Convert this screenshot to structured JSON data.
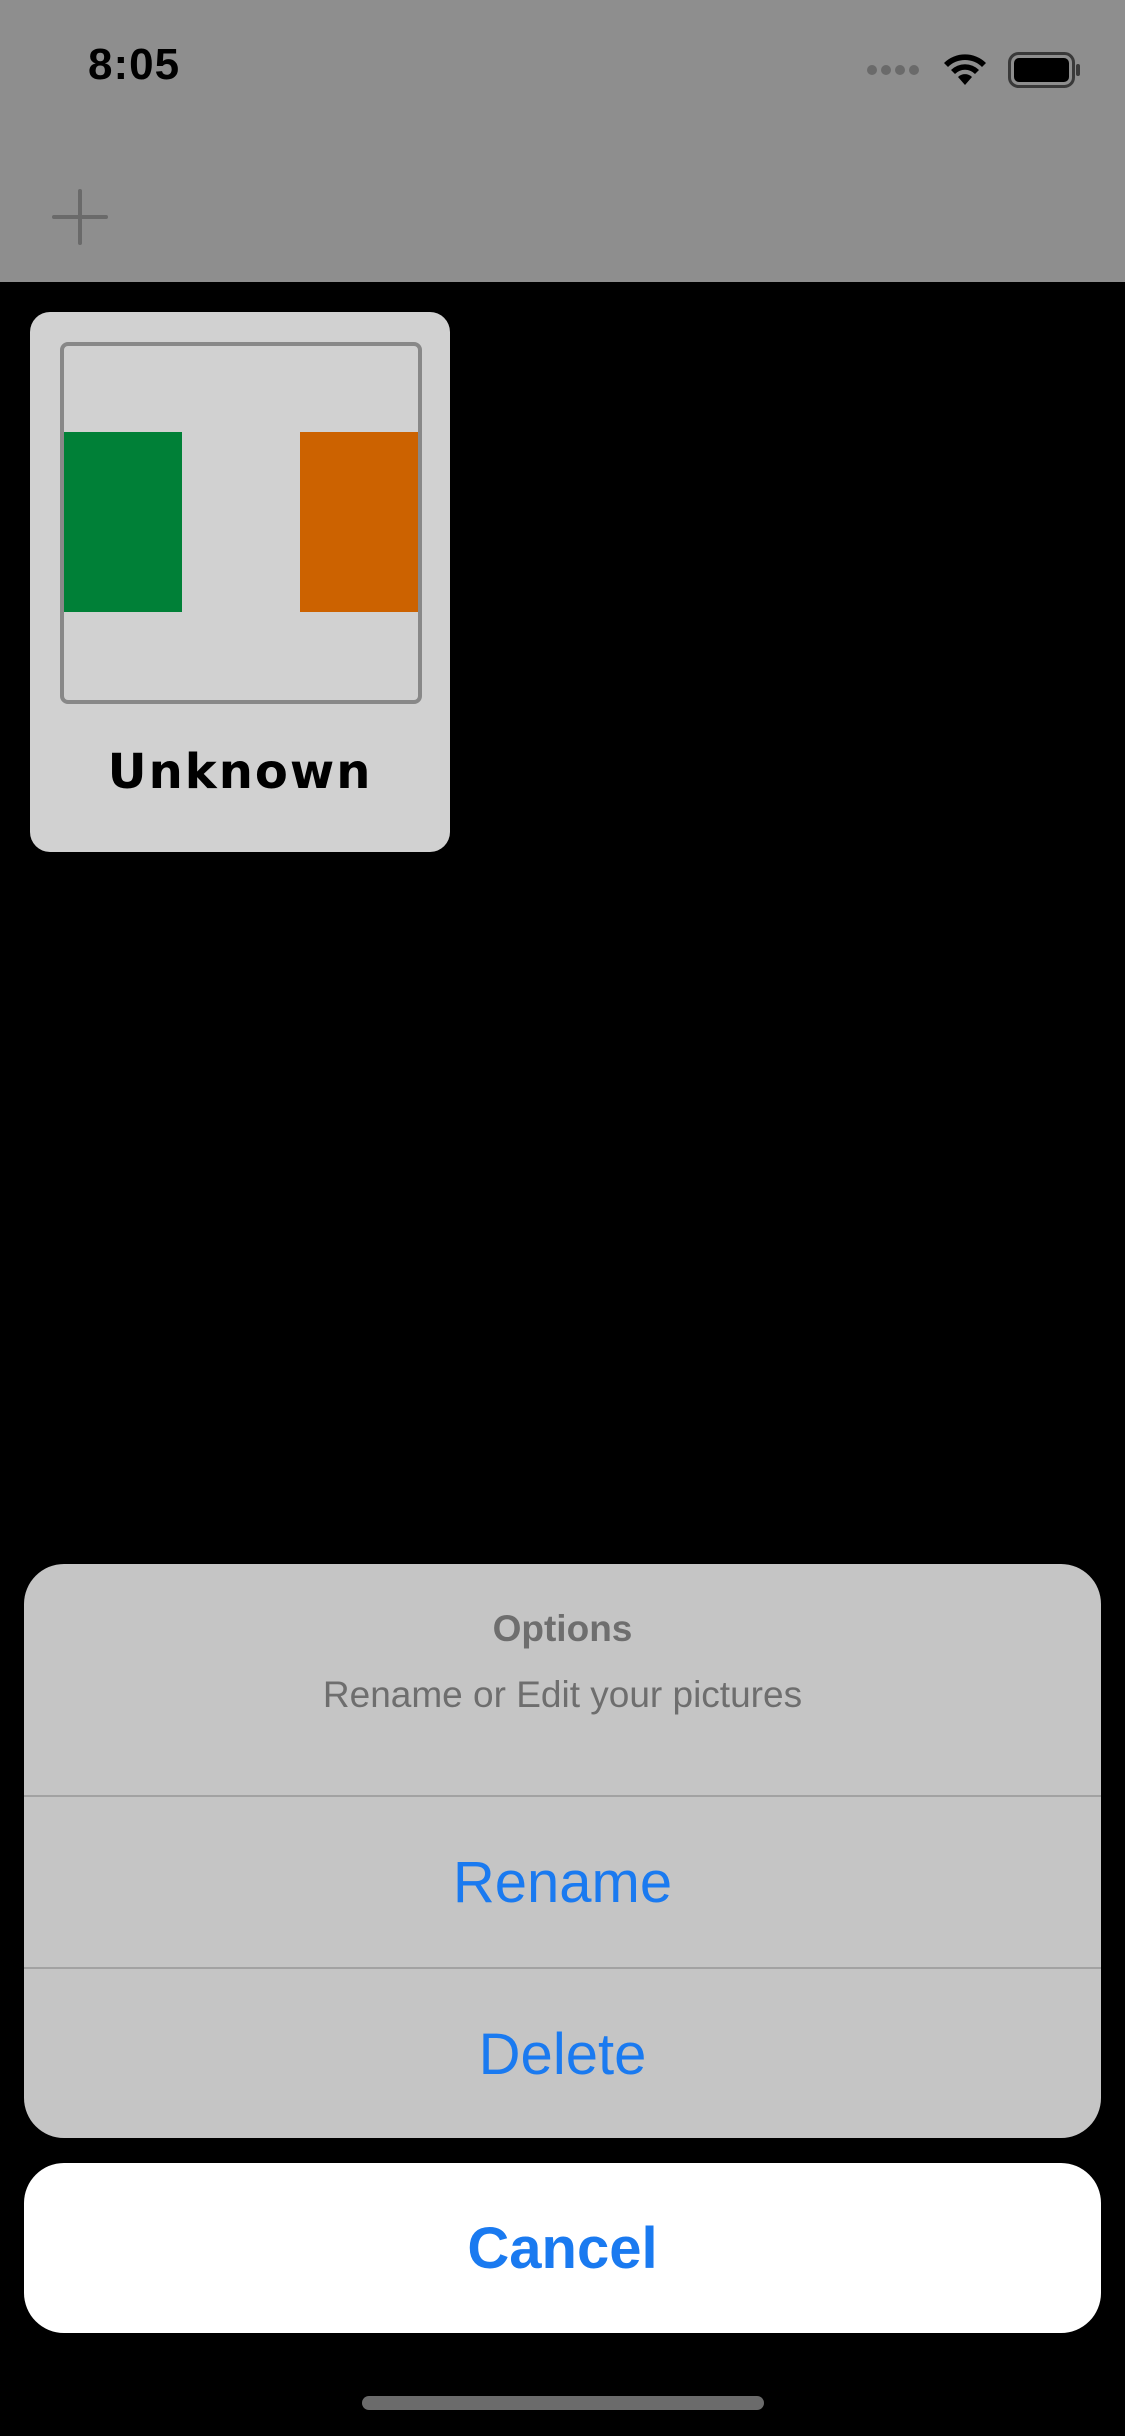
{
  "status_bar": {
    "time": "8:05",
    "icons": [
      "cellular-signal-icon",
      "wifi-icon",
      "battery-icon"
    ]
  },
  "nav_bar": {
    "add_icon": "plus-icon"
  },
  "pictures": [
    {
      "label": "Unknown",
      "thumbnail_colors": [
        "#008037",
        "#d1d1d1",
        "#cc6200"
      ]
    }
  ],
  "action_sheet": {
    "title": "Options",
    "message": "Rename or Edit your pictures",
    "actions": [
      {
        "label": "Rename"
      },
      {
        "label": "Delete"
      }
    ],
    "cancel_label": "Cancel"
  },
  "colors": {
    "accent": "#1a7af0",
    "dim_overlay_bar": "#8e8e8e",
    "sheet_bg": "#c5c5c5",
    "card_bg": "#d1d1d1"
  }
}
